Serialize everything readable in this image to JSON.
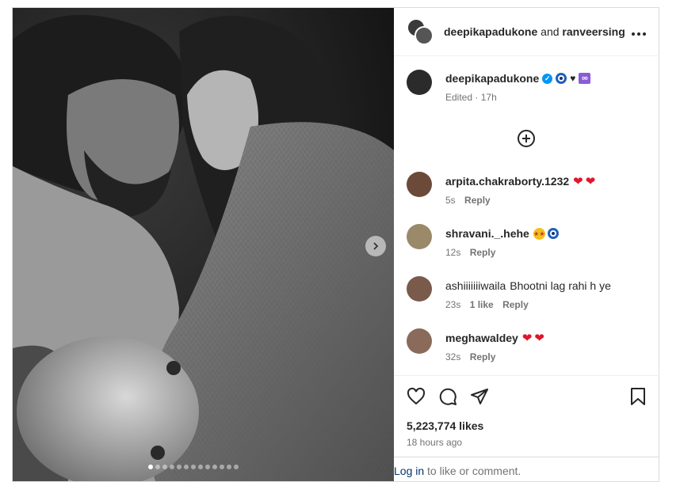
{
  "post": {
    "owners": {
      "user1": "deepikapadukone",
      "joiner": "and",
      "user2": "ranveersing"
    },
    "more_icon": "ellipsis-icon",
    "caption": {
      "username": "deepikapadukone",
      "verified": true,
      "emojis": [
        "nazar-amulet",
        "black-heart",
        "infinity"
      ],
      "edited": "Edited",
      "time": "17h"
    },
    "load_more_icon": "plus-circle-icon",
    "comments": [
      {
        "username": "arpita.chakraborty.1232",
        "text": "",
        "emoji": [
          "red-heart",
          "red-heart"
        ],
        "time": "5s",
        "likes": "",
        "reply": "Reply",
        "avatar_color": "#6b4a3a"
      },
      {
        "username": "shravani._.hehe",
        "text": "",
        "emoji": [
          "star-struck",
          "nazar-amulet"
        ],
        "time": "12s",
        "likes": "",
        "reply": "Reply",
        "avatar_color": "#9a8a6a"
      },
      {
        "username": "ashiiiiiiiwaila",
        "text": "Bhootni lag rahi h ye",
        "emoji": [],
        "time": "23s",
        "likes": "1 like",
        "reply": "Reply",
        "avatar_color": "#7a5a4a"
      },
      {
        "username": "meghawaldey",
        "text": "",
        "emoji": [
          "red-heart",
          "red-heart"
        ],
        "time": "32s",
        "likes": "",
        "reply": "Reply",
        "avatar_color": "#8a6a5a"
      }
    ],
    "likes": "5,223,774 likes",
    "posted": "18 hours ago",
    "login_link": "Log in",
    "login_rest": " to like or comment.",
    "carousel": {
      "count": 13,
      "active_index": 0
    }
  },
  "colors": {
    "link": "#00376b",
    "verified": "#0095f6",
    "heart": "#e0162b",
    "muted": "#737373"
  }
}
